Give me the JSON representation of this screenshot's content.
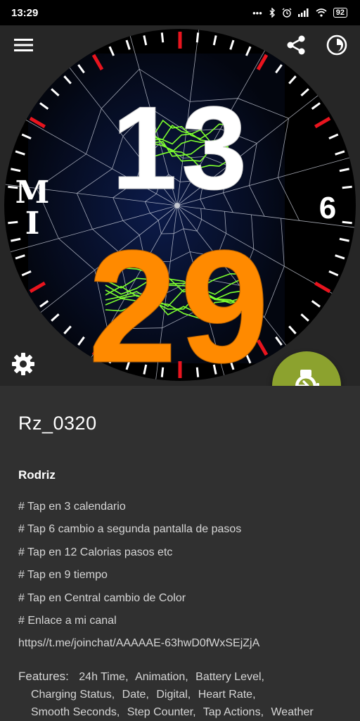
{
  "status_bar": {
    "time": "13:29",
    "icons": [
      "more-horiz-icon",
      "bluetooth-icon",
      "alarm-icon",
      "signal-icon",
      "wifi-icon"
    ],
    "battery": "92"
  },
  "watch_face": {
    "hour": "13",
    "minute": "29",
    "left_label_top": "M",
    "left_label_bottom": "I",
    "right_label": "6",
    "colors": {
      "hour": "#ffffff",
      "minute": "#ff8a00",
      "tick_accent": "#e8141e",
      "lightning": "#7dff2e",
      "face_bg": "#050a1e"
    }
  },
  "actions": {
    "menu_icon": "hamburger-menu-icon",
    "share_icon": "share-icon",
    "theme_icon": "theme-toggle-icon",
    "settings_icon": "gear-icon",
    "install_icon": "watch-install-icon",
    "fab_color": "#8ca22e"
  },
  "details": {
    "name": "Rz_0320",
    "author": "Rodriz",
    "description": [
      "# Tap en 3 calendario",
      "# Tap 6 cambio a segunda pantalla de pasos",
      "# Tap en 12 Calorias pasos etc",
      "# Tap en 9 tiempo",
      "# Tap en Central cambio de Color",
      "# Enlace a mi canal",
      "https//t.me/joinchat/AAAAAE-63hwD0fWxSEjZjA"
    ],
    "features_label": "Features:",
    "features": [
      "24h Time,",
      "Animation,",
      "Battery Level,",
      "Charging Status,",
      "Date,",
      "Digital,",
      "Heart Rate,",
      "Smooth Seconds,",
      "Step Counter,",
      "Tap Actions,",
      "Weather"
    ]
  }
}
